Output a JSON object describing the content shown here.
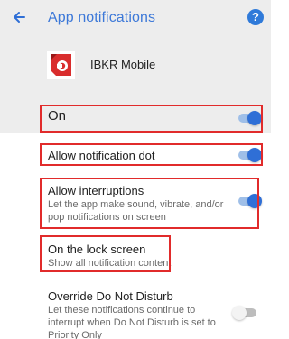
{
  "header": {
    "title": "App notifications",
    "back_icon": "arrow-left-icon",
    "help_icon": "help-icon",
    "help_symbol": "?"
  },
  "app": {
    "name": "IBKR Mobile",
    "logo_icon": "ibkr-logo-icon",
    "brand_red": "#d92d2d"
  },
  "settings": {
    "on": {
      "label": "On",
      "enabled": true
    },
    "allow_notification_dot": {
      "label": "Allow notification dot",
      "enabled": true
    },
    "allow_interruptions": {
      "label": "Allow interruptions",
      "description": "Let the app make sound, vibrate, and/or pop notifications on screen",
      "enabled": true
    },
    "on_lock_screen": {
      "label": "On the lock screen",
      "value": "Show all notification content"
    },
    "override_dnd": {
      "label": "Override Do Not Disturb",
      "description": "Let these notifications continue to interrupt when Do Not Disturb is set to Priority Only",
      "enabled": false
    }
  },
  "colors": {
    "accent_blue": "#2f6fd6",
    "title_blue": "#3c78d8",
    "highlight_red": "#e12b2b",
    "header_bg": "#ededed"
  }
}
